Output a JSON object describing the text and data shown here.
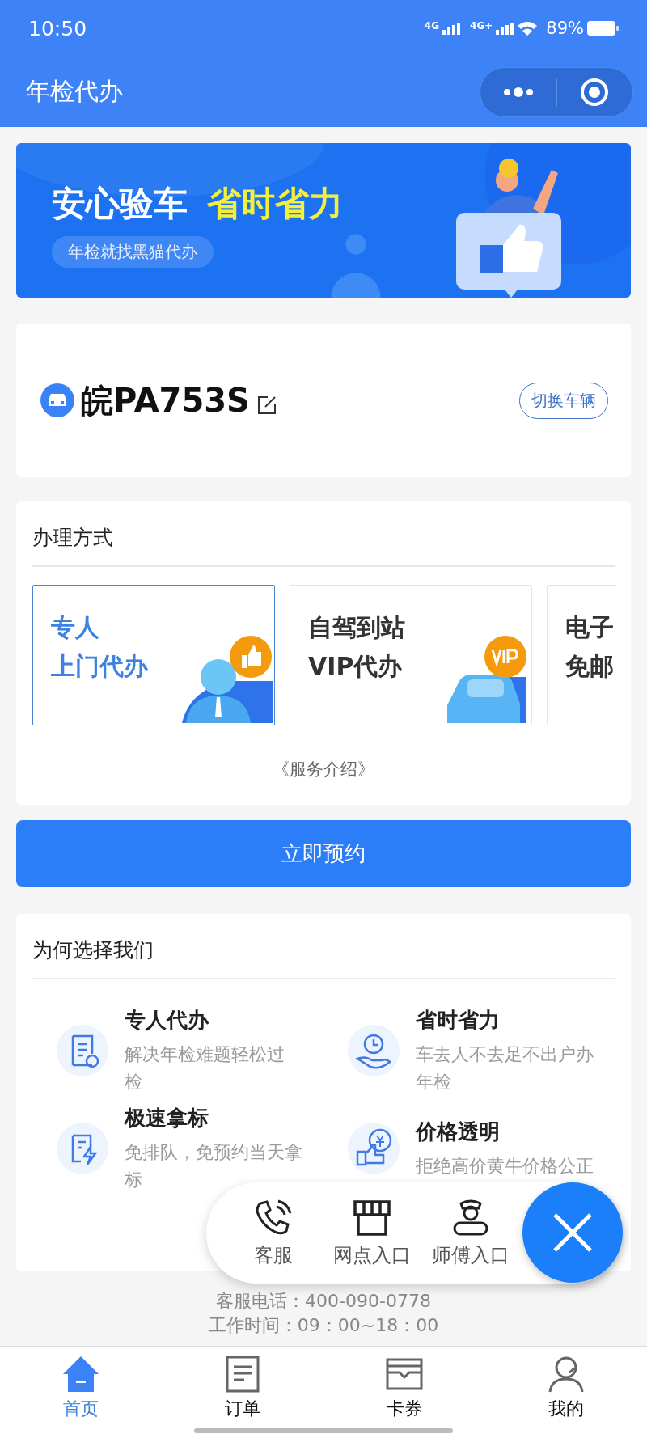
{
  "status_bar": {
    "time": "10:50",
    "network_1": "4G",
    "network_2": "4G+",
    "battery": "89%"
  },
  "nav_bar": {
    "title": "年检代办"
  },
  "banner": {
    "headline": "安心验车",
    "highlight": "省时省力",
    "tagline": "年检就找黑猫代办"
  },
  "vehicle": {
    "plate": "皖PA753S",
    "switch_button": "切换车辆"
  },
  "service": {
    "title": "办理方式",
    "options": [
      {
        "lines": [
          "专人",
          "上门代办"
        ],
        "selected": true,
        "kind": "agent"
      },
      {
        "lines": [
          "自驾到站",
          "VIP代办"
        ],
        "selected": false,
        "kind": "vip"
      },
      {
        "lines": [
          "电子",
          "免邮"
        ],
        "selected": false,
        "kind": "plain"
      }
    ],
    "intro_link": "《服务介绍》"
  },
  "book_button": "立即预约",
  "why": {
    "title": "为何选择我们",
    "items": [
      {
        "title": "专人代办",
        "desc_lines": [
          "解决年检难题轻松过",
          "检"
        ],
        "kind": "document"
      },
      {
        "title": "省时省力",
        "desc_lines": [
          "车去人不去足不出户办",
          "年检"
        ],
        "kind": "clock"
      },
      {
        "title": "极速拿标",
        "desc_lines": [
          "免排队，免预约当天拿",
          "标"
        ],
        "kind": "fast"
      },
      {
        "title": "价格透明",
        "desc_lines": [
          "拒绝高价黄牛价格公正"
        ],
        "kind": "price"
      }
    ]
  },
  "float_menu": {
    "items": [
      {
        "label": "客服",
        "kind": "phone"
      },
      {
        "label": "网点入口",
        "kind": "store"
      },
      {
        "label": "师傅入口",
        "kind": "master"
      }
    ]
  },
  "footer": {
    "phone": "客服电话：400-090-0778",
    "hours": "工作时间：09：00~18：00"
  },
  "tab_bar": [
    {
      "label": "首页",
      "selected": true,
      "kind": "home"
    },
    {
      "label": "订单",
      "selected": false,
      "kind": "order"
    },
    {
      "label": "卡券",
      "selected": false,
      "kind": "card"
    },
    {
      "label": "我的",
      "selected": false,
      "kind": "me"
    }
  ]
}
